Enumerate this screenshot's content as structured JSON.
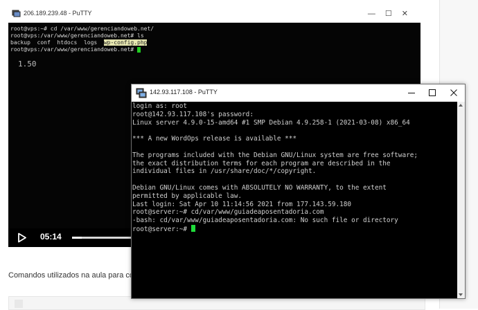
{
  "background": {
    "window_title": "206.189.239.48 - PuTTY",
    "terminal_lines": [
      "root@vps:~# cd /var/www/gerenciandoweb.net/",
      "root@vps:/var/www/gerenciandoweb.net# ls",
      "backup  conf  htdocs  logs  "
    ],
    "ls_highlight": "wp-config.php",
    "prompt_line": "root@vps:/var/www/gerenciandoweb.net# ",
    "zoom_text": "1.50",
    "video_time": "05:14",
    "video_progress": 0.16
  },
  "caption": "Comandos utilizados na aula para co",
  "putty": {
    "title": "142.93.117.108 - PuTTY",
    "lines": [
      "login as: root",
      "root@142.93.117.108's password:",
      "Linux server 4.9.0-15-amd64 #1 SMP Debian 4.9.258-1 (2021-03-08) x86_64",
      "",
      "*** A new WordOps release is available ***",
      "",
      "The programs included with the Debian GNU/Linux system are free software;",
      "the exact distribution terms for each program are described in the",
      "individual files in /usr/share/doc/*/copyright.",
      "",
      "Debian GNU/Linux comes with ABSOLUTELY NO WARRANTY, to the extent",
      "permitted by applicable law.",
      "Last login: Sat Apr 10 11:14:56 2021 from 177.143.59.180",
      "root@server:~# cd/var/www/guiadeaposentadoria.com",
      "-bash: cd/var/www/guiadeaposentadoria.com: No such file or directory"
    ],
    "prompt": "root@server:~# "
  },
  "colors": {
    "cursor": "#1fdc3a",
    "terminal_bg": "#000000",
    "terminal_fg": "#d0d0d0"
  }
}
